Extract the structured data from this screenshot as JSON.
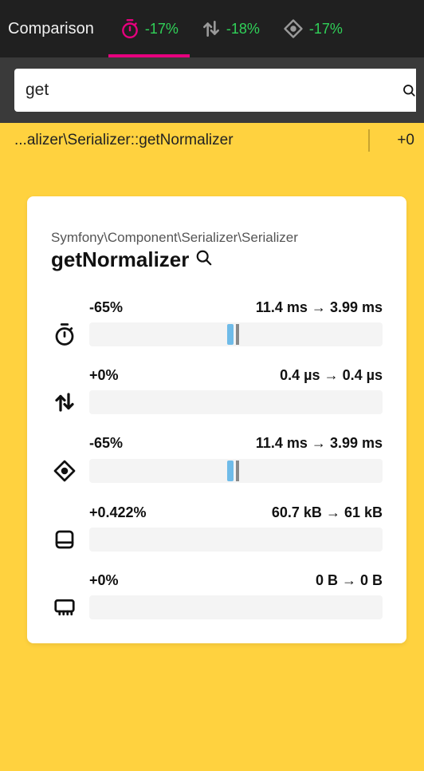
{
  "header": {
    "title": "Comparison",
    "tabs": [
      {
        "id": "time",
        "pct": "-17%",
        "active": true
      },
      {
        "id": "io",
        "pct": "-18%",
        "active": false
      },
      {
        "id": "cpu",
        "pct": "-17%",
        "active": false
      }
    ]
  },
  "search": {
    "value": "get"
  },
  "result": {
    "header": {
      "path": "...alizer\\Serializer::getNormalizer",
      "delta": "+0"
    }
  },
  "card": {
    "namespace": "Symfony\\Component\\Serializer\\Serializer",
    "function_name": "getNormalizer",
    "metrics": [
      {
        "id": "time",
        "pct": "-65%",
        "before": "11.4 ms",
        "after": "3.99 ms"
      },
      {
        "id": "io",
        "pct": "+0%",
        "before": "0.4 µs",
        "after": "0.4 µs"
      },
      {
        "id": "cpu",
        "pct": "-65%",
        "before": "11.4 ms",
        "after": "3.99 ms"
      },
      {
        "id": "memory",
        "pct": "+0.422%",
        "before": "60.7 kB",
        "after": "61 kB"
      },
      {
        "id": "network",
        "pct": "+0%",
        "before": "0 B",
        "after": "0 B"
      }
    ]
  },
  "colors": {
    "accent_pink": "#e6007e",
    "positive_green": "#30d158",
    "highlight_yellow": "#ffd23f",
    "bar_blue": "#6fbbe8"
  }
}
